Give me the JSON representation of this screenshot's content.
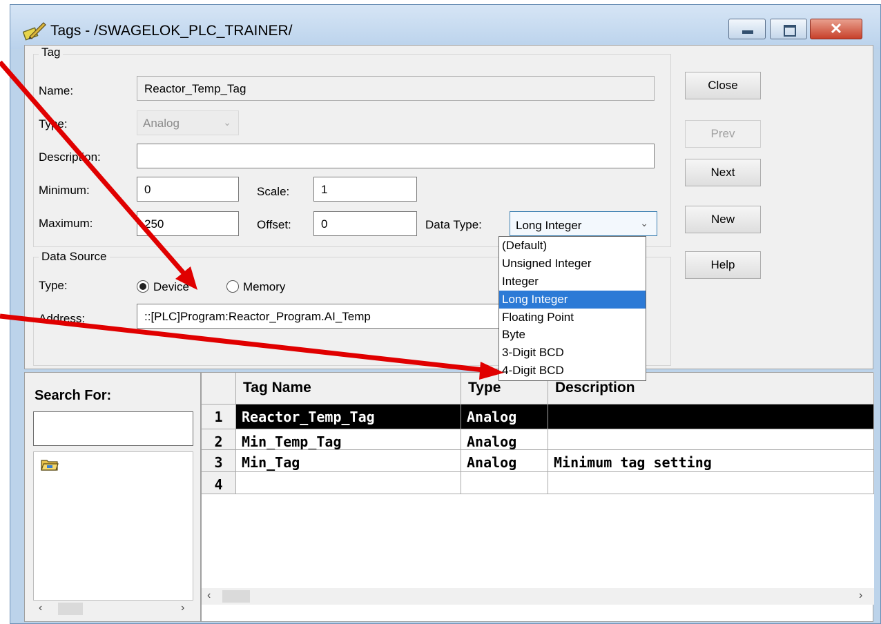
{
  "window": {
    "title": "Tags - /SWAGELOK_PLC_TRAINER/",
    "close_glyph": "✕"
  },
  "tag_group": {
    "label": "Tag",
    "name_label": "Name:",
    "name_value": "Reactor_Temp_Tag",
    "type_label": "Type:",
    "type_value": "Analog",
    "description_label": "Description:",
    "description_value": "",
    "minimum_label": "Minimum:",
    "minimum_value": "0",
    "maximum_label": "Maximum:",
    "maximum_value": "250",
    "scale_label": "Scale:",
    "scale_value": "1",
    "offset_label": "Offset:",
    "offset_value": "0",
    "data_type_label": "Data Type:",
    "data_type_value": "Long Integer"
  },
  "data_source": {
    "label": "Data Source",
    "type_label": "Type:",
    "radio_device": "Device",
    "radio_memory": "Memory",
    "selected": "Device",
    "address_label": "Address:",
    "address_value": "::[PLC]Program:Reactor_Program.AI_Temp"
  },
  "side_buttons": {
    "close": "Close",
    "prev": "Prev",
    "next": "Next",
    "new": "New",
    "help": "Help"
  },
  "data_type_options": [
    "(Default)",
    "Unsigned Integer",
    "Integer",
    "Long Integer",
    "Floating Point",
    "Byte",
    "3-Digit BCD",
    "4-Digit BCD"
  ],
  "data_type_selected_index": 3,
  "search": {
    "label": "Search For:",
    "value": ""
  },
  "grid": {
    "columns": [
      "Tag Name",
      "Type",
      "Description"
    ],
    "rows": [
      {
        "num": "1",
        "name": "Reactor_Temp_Tag",
        "type": "Analog",
        "description": ""
      },
      {
        "num": "2",
        "name": "Min_Temp_Tag",
        "type": "Analog",
        "description": ""
      },
      {
        "num": "3",
        "name": "Min_Tag",
        "type": "Analog",
        "description": "Minimum tag setting"
      },
      {
        "num": "4",
        "name": "",
        "type": "",
        "description": ""
      }
    ],
    "selected_row": 0
  },
  "icons": {
    "title": "tag-pencil-icon",
    "folder": "folder-icon",
    "dropdown": "chevron-down-icon",
    "scroll_left": "‹",
    "scroll_right": "›"
  },
  "colors": {
    "highlight": "#2c7ad6",
    "annotation_arrow": "#e00000",
    "selected_row": "#000000"
  }
}
